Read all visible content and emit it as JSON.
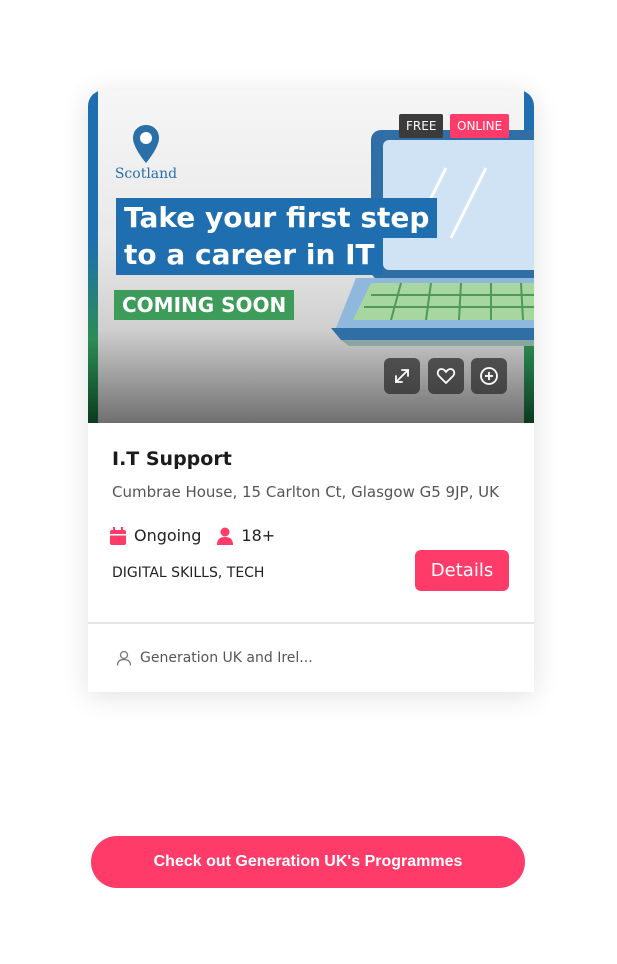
{
  "card": {
    "banner": {
      "logo_text": "Scotland",
      "headline_line1": "Take your first step",
      "headline_line2": "to a career in IT",
      "coming_soon": "COMING SOON",
      "badges": {
        "free": "FREE",
        "online": "ONLINE"
      },
      "icons": {
        "expand": "expand-icon",
        "favorite": "heart-icon",
        "add": "plus-circle-icon"
      }
    },
    "title": "I.T Support",
    "address": "Cumbrae House, 15 Carlton Ct, Glasgow G5 9JP, UK",
    "schedule": "Ongoing",
    "age": "18+",
    "tags": "DIGITAL SKILLS, TECH",
    "details_label": "Details",
    "provider": "Generation UK and Irel..."
  },
  "cta_label": "Check out Generation UK's Programmes",
  "colors": {
    "accent": "#ff3b6a",
    "banner_blue": "#1f6fb0",
    "banner_green": "#3e9c5a",
    "badge_dark": "#3b3b3b"
  }
}
